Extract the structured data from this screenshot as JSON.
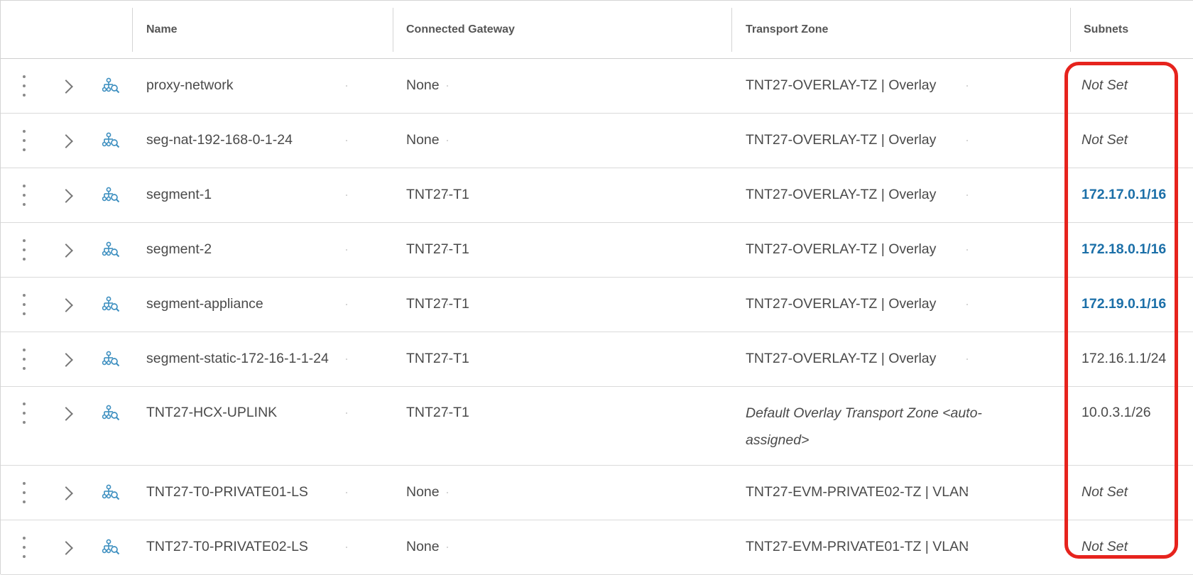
{
  "columns": {
    "name": "Name",
    "gateway": "Connected Gateway",
    "transport_zone": "Transport Zone",
    "subnets": "Subnets"
  },
  "rows": [
    {
      "name": "proxy-network",
      "gateway": "None",
      "transport_zone": "TNT27-OVERLAY-TZ | Overlay",
      "subnets": "Not Set",
      "subnets_style": "italic"
    },
    {
      "name": "seg-nat-192-168-0-1-24",
      "gateway": "None",
      "transport_zone": "TNT27-OVERLAY-TZ | Overlay",
      "subnets": "Not Set",
      "subnets_style": "italic"
    },
    {
      "name": "segment-1",
      "gateway": "TNT27-T1",
      "transport_zone": "TNT27-OVERLAY-TZ | Overlay",
      "subnets": "172.17.0.1/16",
      "subnets_style": "link"
    },
    {
      "name": "segment-2",
      "gateway": "TNT27-T1",
      "transport_zone": "TNT27-OVERLAY-TZ | Overlay",
      "subnets": "172.18.0.1/16",
      "subnets_style": "link"
    },
    {
      "name": "segment-appliance",
      "gateway": "TNT27-T1",
      "transport_zone": "TNT27-OVERLAY-TZ | Overlay",
      "subnets": "172.19.0.1/16",
      "subnets_style": "link"
    },
    {
      "name": "segment-static-172-16-1-1-24",
      "gateway": "TNT27-T1",
      "transport_zone": "TNT27-OVERLAY-TZ | Overlay",
      "subnets": "172.16.1.1/24",
      "subnets_style": "plain"
    },
    {
      "name": "TNT27-HCX-UPLINK",
      "gateway": "TNT27-T1",
      "transport_zone": "Default Overlay Transport Zone <auto-assigned>",
      "transport_zone_style": "italic",
      "subnets": "10.0.3.1/26",
      "subnets_style": "plain"
    },
    {
      "name": "TNT27-T0-PRIVATE01-LS",
      "gateway": "None",
      "transport_zone": "TNT27-EVM-PRIVATE02-TZ | VLAN",
      "subnets": "Not Set",
      "subnets_style": "italic"
    },
    {
      "name": "TNT27-T0-PRIVATE02-LS",
      "gateway": "None",
      "transport_zone": "TNT27-EVM-PRIVATE01-TZ | VLAN",
      "subnets": "Not Set",
      "subnets_style": "italic"
    }
  ],
  "icons": {
    "row_actions": "kebab-icon",
    "expand": "chevron-right-icon",
    "segment": "segment-network-icon"
  },
  "colors": {
    "link": "#1b6fa8",
    "highlight": "#e6231d",
    "icon": "#3d8fc0"
  }
}
